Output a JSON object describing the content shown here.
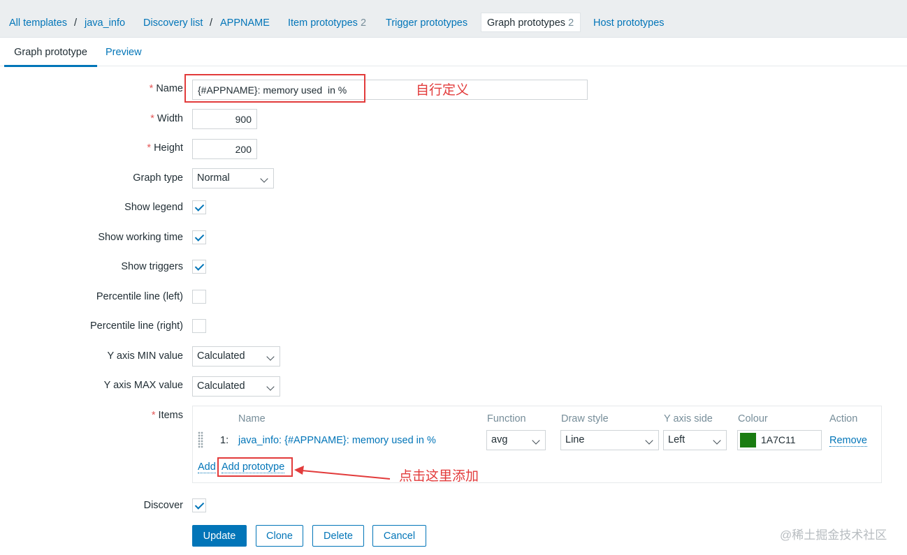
{
  "breadcrumb": {
    "all_templates": "All templates",
    "sep": "/",
    "template": "java_info",
    "discovery_list": "Discovery list",
    "rule": "APPNAME",
    "item_prototypes": "Item prototypes",
    "item_prototypes_count": "2",
    "trigger_prototypes": "Trigger prototypes",
    "graph_prototypes": "Graph prototypes",
    "graph_prototypes_count": "2",
    "host_prototypes": "Host prototypes"
  },
  "tabs": {
    "graph_prototype": "Graph prototype",
    "preview": "Preview"
  },
  "required_mark": "*",
  "form": {
    "name_label": "Name",
    "name_value": "{#APPNAME}: memory used  in %",
    "width_label": "Width",
    "width_value": "900",
    "height_label": "Height",
    "height_value": "200",
    "graph_type_label": "Graph type",
    "graph_type_value": "Normal",
    "show_legend_label": "Show legend",
    "show_legend": true,
    "show_working_time_label": "Show working time",
    "show_working_time": true,
    "show_triggers_label": "Show triggers",
    "show_triggers": true,
    "percentile_left_label": "Percentile line (left)",
    "percentile_left": false,
    "percentile_right_label": "Percentile line (right)",
    "percentile_right": false,
    "ymin_label": "Y axis MIN value",
    "ymin_value": "Calculated",
    "ymax_label": "Y axis MAX value",
    "ymax_value": "Calculated",
    "items_label": "Items",
    "discover_label": "Discover",
    "discover": true
  },
  "items_table": {
    "headers": {
      "name": "Name",
      "function": "Function",
      "draw_style": "Draw style",
      "y_axis_side": "Y axis side",
      "colour": "Colour",
      "action": "Action"
    },
    "rows": [
      {
        "index": "1:",
        "name": "java_info: {#APPNAME}: memory used in %",
        "function": "avg",
        "draw_style": "Line",
        "y_axis_side": "Left",
        "colour_hex": "1A7C11",
        "colour_swatch": "#1A7C11",
        "action": "Remove"
      }
    ],
    "add_label": "Add",
    "add_prototype_label": "Add prototype"
  },
  "buttons": {
    "update": "Update",
    "clone": "Clone",
    "delete": "Delete",
    "cancel": "Cancel"
  },
  "annotations": {
    "name_note": "自行定义",
    "add_note": "点击这里添加"
  },
  "watermark": "@稀土掘金技术社区",
  "colors": {
    "accent": "#0275b8",
    "annotation": "#e23b3b"
  }
}
